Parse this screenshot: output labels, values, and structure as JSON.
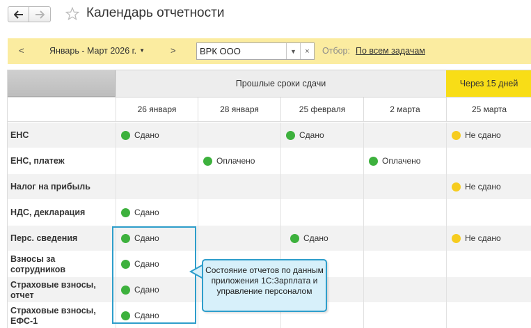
{
  "window": {
    "title": "Календарь отчетности"
  },
  "toolbar": {
    "prev_label": "<",
    "period": "Январь - Март 2026 г.",
    "next_label": ">",
    "organization": "ВРК ООО",
    "filter_label": "Отбор:",
    "filter_value": "По всем задачам"
  },
  "grid": {
    "header_past": "Прошлые сроки сдачи",
    "header_soon": "Через 15 дней",
    "dates": [
      "26 января",
      "28 января",
      "25 февраля",
      "2 марта",
      "25 марта"
    ],
    "rows": [
      {
        "label": "ЕНС",
        "cells": [
          {
            "col": 0,
            "text": "Сдано",
            "color": "green"
          },
          {
            "col": 2,
            "text": "Сдано",
            "color": "green"
          },
          {
            "col": 4,
            "text": "Не сдано",
            "color": "yellow"
          }
        ]
      },
      {
        "label": "ЕНС, платеж",
        "cells": [
          {
            "col": 1,
            "text": "Оплачено",
            "color": "green"
          },
          {
            "col": 3,
            "text": "Оплачено",
            "color": "green"
          }
        ]
      },
      {
        "label": "Налог на прибыль",
        "cells": [
          {
            "col": 4,
            "text": "Не сдано",
            "color": "yellow"
          }
        ]
      },
      {
        "label": "НДС, декларация",
        "cells": [
          {
            "col": 0,
            "text": "Сдано",
            "color": "green"
          }
        ]
      },
      {
        "label": "Перс. сведения",
        "cells": [
          {
            "col": 0,
            "text": "Сдано",
            "color": "green"
          },
          {
            "col": 2,
            "text": "Сдано",
            "color": "green"
          },
          {
            "col": 4,
            "text": "Не сдано",
            "color": "yellow"
          }
        ]
      },
      {
        "label": "Взносы за сотрудников",
        "cells": [
          {
            "col": 0,
            "text": "Сдано",
            "color": "green"
          }
        ]
      },
      {
        "label": "Страховые взносы, отчет",
        "cells": [
          {
            "col": 0,
            "text": "Сдано",
            "color": "green"
          }
        ]
      },
      {
        "label": "Страховые взносы, ЕФС-1",
        "cells": [
          {
            "col": 0,
            "text": "Сдано",
            "color": "green"
          }
        ]
      }
    ]
  },
  "callout": {
    "text": "Состояние отчетов по данным приложения 1С:Зарплата и управление персоналом"
  },
  "colors": {
    "accent": "#f8dd17",
    "toolbar_bg": "#fbeca0",
    "done": "#3db13d",
    "pending": "#f6cc1f",
    "highlight": "#2e9ecb",
    "callout_bg": "#d7f0fa"
  },
  "icons": {
    "back": "arrow-left-icon",
    "forward": "arrow-right-icon",
    "favorite": "star-icon",
    "dropdown": "caret-down-icon",
    "clear": "close-icon",
    "status": "status-dot-icon"
  }
}
